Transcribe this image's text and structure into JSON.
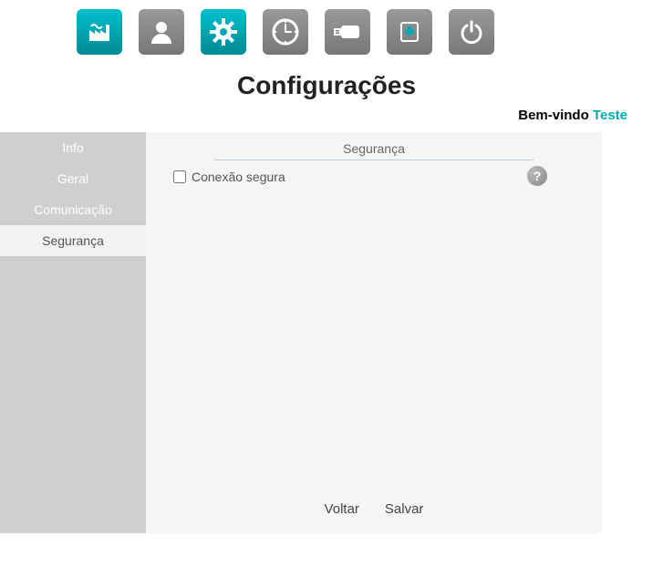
{
  "page_title": "Configurações",
  "welcome": {
    "label": "Bem-vindo",
    "user": "Teste"
  },
  "top_icons": [
    {
      "name": "factory-icon",
      "active": true
    },
    {
      "name": "user-icon",
      "active": false
    },
    {
      "name": "gear-icon",
      "active": true
    },
    {
      "name": "clock-icon",
      "active": false
    },
    {
      "name": "usb-icon",
      "active": false
    },
    {
      "name": "download-icon",
      "active": false
    },
    {
      "name": "power-icon",
      "active": false
    }
  ],
  "sidebar": {
    "items": [
      {
        "label": "Info",
        "active": false
      },
      {
        "label": "Geral",
        "active": false
      },
      {
        "label": "Comunicação",
        "active": false
      },
      {
        "label": "Segurança",
        "active": true
      }
    ]
  },
  "content": {
    "section_title": "Segurança",
    "secure_connection_label": "Conexão segura",
    "secure_connection_checked": false,
    "help_tooltip": "?"
  },
  "footer": {
    "back_label": "Voltar",
    "save_label": "Salvar"
  },
  "colors": {
    "accent_teal": "#00aab5",
    "sidebar_bg": "#cfcfcf",
    "panel_bg": "#f5f5f5"
  }
}
